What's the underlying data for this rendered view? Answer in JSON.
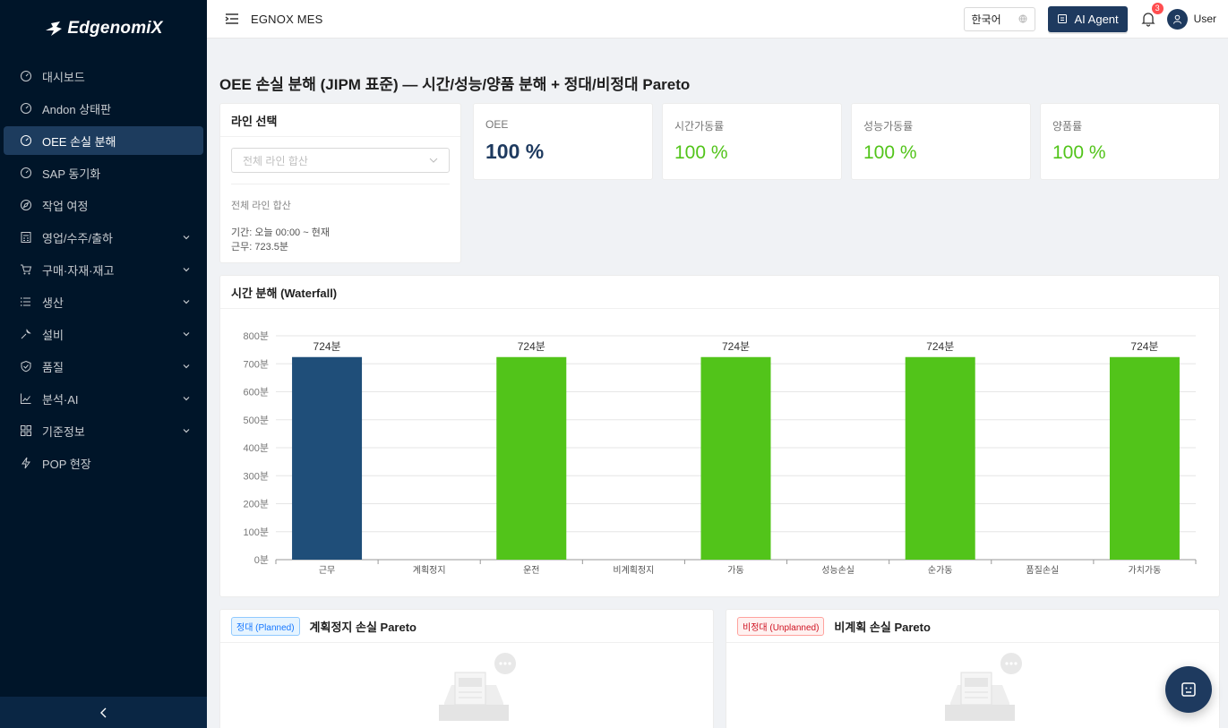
{
  "brand": {
    "name": "EdgenomiX"
  },
  "sidebar": {
    "items": [
      {
        "label": "대시보드",
        "icon": "dashboard-icon",
        "active": false,
        "expandable": false
      },
      {
        "label": "Andon 상태판",
        "icon": "dashboard-icon",
        "active": false,
        "expandable": false
      },
      {
        "label": "OEE 손실 분해",
        "icon": "dashboard-icon",
        "active": true,
        "expandable": false
      },
      {
        "label": "SAP 동기화",
        "icon": "dashboard-icon",
        "active": false,
        "expandable": false
      },
      {
        "label": "작업 여정",
        "icon": "compass-icon",
        "active": false,
        "expandable": false
      },
      {
        "label": "영업/수주/출하",
        "icon": "calculator-icon",
        "active": false,
        "expandable": true
      },
      {
        "label": "구매·자재·재고",
        "icon": "cart-icon",
        "active": false,
        "expandable": true
      },
      {
        "label": "생산",
        "icon": "list-icon",
        "active": false,
        "expandable": true
      },
      {
        "label": "설비",
        "icon": "wrench-icon",
        "active": false,
        "expandable": true
      },
      {
        "label": "품질",
        "icon": "shield-check-icon",
        "active": false,
        "expandable": true
      },
      {
        "label": "분석·AI",
        "icon": "line-chart-icon",
        "active": false,
        "expandable": true
      },
      {
        "label": "기준정보",
        "icon": "appstore-icon",
        "active": false,
        "expandable": true
      },
      {
        "label": "POP 현장",
        "icon": "thunderbolt-icon",
        "active": false,
        "expandable": false
      }
    ]
  },
  "header": {
    "title": "EGNOX MES",
    "language": "한국어",
    "ai_agent_label": "AI Agent",
    "notification_count": "3",
    "user_name": "User"
  },
  "page": {
    "title": "OEE 손실 분해 (JIPM 표준) — 시간/성능/양품 분해 + 정대/비정대 Pareto"
  },
  "line_select": {
    "title": "라인 선택",
    "placeholder": "전체 라인 합산",
    "summary": "전체 라인 합산",
    "period": "기간: 오늘 00:00 ~ 현재",
    "work": "근무: 723.5분"
  },
  "kpis": [
    {
      "label": "OEE",
      "value": "100 %"
    },
    {
      "label": "시간가동률",
      "value": "100 %"
    },
    {
      "label": "성능가동률",
      "value": "100 %"
    },
    {
      "label": "양품률",
      "value": "100 %"
    }
  ],
  "waterfall": {
    "title": "시간 분해 (Waterfall)"
  },
  "chart_data": {
    "type": "bar",
    "title": "시간 분해 (Waterfall)",
    "categories": [
      "근무",
      "계획정지",
      "운전",
      "비계획정지",
      "가동",
      "성능손실",
      "순가동",
      "품질손실",
      "가치가동"
    ],
    "values": [
      724,
      0,
      724,
      0,
      724,
      0,
      724,
      0,
      724
    ],
    "data_labels": [
      "724분",
      "",
      "724분",
      "",
      "724분",
      "",
      "724분",
      "",
      "724분"
    ],
    "bar_colors": [
      "#1f4e79",
      "#52c41a",
      "#52c41a",
      "#52c41a",
      "#52c41a",
      "#52c41a",
      "#52c41a",
      "#52c41a",
      "#52c41a"
    ],
    "ylim": [
      0,
      800
    ],
    "yticks": [
      "0분",
      "100분",
      "200분",
      "300분",
      "400분",
      "500분",
      "600분",
      "700분",
      "800분"
    ],
    "ytick_values": [
      0,
      100,
      200,
      300,
      400,
      500,
      600,
      700,
      800
    ],
    "grid": true,
    "xlabel": "",
    "ylabel": ""
  },
  "pareto": {
    "planned": {
      "tag": "정대 (Planned)",
      "title": "계획정지 손실 Pareto"
    },
    "unplanned": {
      "tag": "비정대 (Unplanned)",
      "title": "비계획 손실 Pareto"
    }
  },
  "colors": {
    "sidebar_bg": "#001529",
    "primary": "#1e3a5f",
    "green": "#52c41a",
    "bar_primary": "#1f4e79"
  }
}
